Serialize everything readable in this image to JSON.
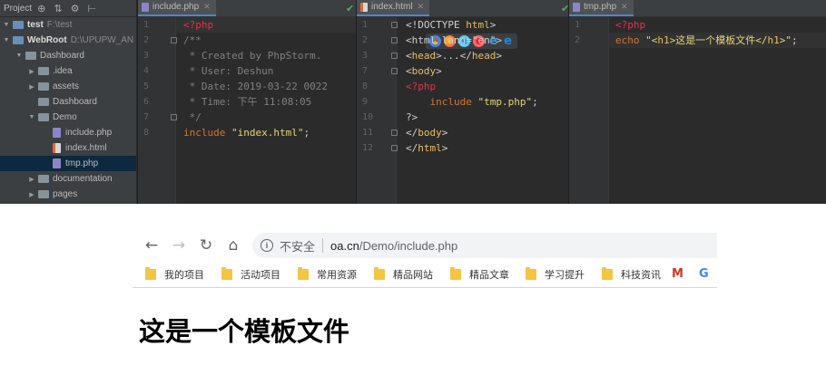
{
  "project_panel": {
    "title": "Project",
    "toolbar_icons": [
      "target-icon",
      "collapse-icon",
      "settings-icon",
      "hide-icon"
    ],
    "tree": [
      {
        "name": "test",
        "path": "F:\\test",
        "depth": 0,
        "expanded": true,
        "kind": "root"
      },
      {
        "name": "WebRoot",
        "path": "D:\\UPUPW_AN",
        "depth": 0,
        "expanded": true,
        "kind": "root"
      },
      {
        "name": "Dashboard",
        "path": "",
        "depth": 1,
        "expanded": true,
        "kind": "folder"
      },
      {
        "name": ".idea",
        "path": "",
        "depth": 2,
        "expanded": false,
        "kind": "folder"
      },
      {
        "name": "assets",
        "path": "",
        "depth": 2,
        "expanded": false,
        "kind": "folder"
      },
      {
        "name": "Dashboard",
        "path": "",
        "depth": 2,
        "expanded": null,
        "kind": "folder"
      },
      {
        "name": "Demo",
        "path": "",
        "depth": 2,
        "expanded": true,
        "kind": "folder"
      },
      {
        "name": "include.php",
        "path": "",
        "depth": 3,
        "expanded": null,
        "kind": "php"
      },
      {
        "name": "index.html",
        "path": "",
        "depth": 3,
        "expanded": null,
        "kind": "html"
      },
      {
        "name": "tmp.php",
        "path": "",
        "depth": 3,
        "expanded": null,
        "kind": "php",
        "selected": true
      },
      {
        "name": "documentation",
        "path": "",
        "depth": 2,
        "expanded": false,
        "kind": "folder"
      },
      {
        "name": "pages",
        "path": "",
        "depth": 2,
        "expanded": false,
        "kind": "folder"
      }
    ]
  },
  "editors": [
    {
      "tab": "include.php",
      "lines": [
        {
          "n": "1",
          "parts": [
            [
              "<?php",
              "php"
            ]
          ]
        },
        {
          "n": "2",
          "parts": [
            [
              "/**",
              "cmt"
            ]
          ]
        },
        {
          "n": "3",
          "parts": [
            [
              " * Created by PhpStorm.",
              "cmt"
            ]
          ]
        },
        {
          "n": "4",
          "parts": [
            [
              " * User: Deshun",
              "cmt"
            ]
          ]
        },
        {
          "n": "5",
          "parts": [
            [
              " * Date: 2019-03-22 0022",
              "cmt"
            ]
          ]
        },
        {
          "n": "6",
          "parts": [
            [
              " * Time: 下午 11:08:05",
              "cmt"
            ]
          ]
        },
        {
          "n": "7",
          "parts": [
            [
              " */",
              "cmt"
            ]
          ]
        },
        {
          "n": "8",
          "parts": [
            [
              "include ",
              "phpkw"
            ],
            [
              "\"index.html\"",
              "strw"
            ],
            [
              ";",
              "ident"
            ]
          ]
        }
      ]
    },
    {
      "tab": "index.html",
      "lines": [
        {
          "n": "1",
          "parts": [
            [
              "<!DOCTYPE ",
              "ident"
            ],
            [
              "html",
              "tag"
            ],
            [
              ">",
              "ident"
            ]
          ]
        },
        {
          "n": "2",
          "parts": [
            [
              "<html lang=\"en\">",
              "ident"
            ]
          ]
        },
        {
          "n": "3",
          "parts": [
            [
              "<",
              "ident"
            ],
            [
              "head",
              "tag"
            ],
            [
              ">...</",
              "ident"
            ],
            [
              "head",
              "tag"
            ],
            [
              ">",
              "ident"
            ]
          ]
        },
        {
          "n": "7",
          "parts": [
            [
              "<",
              "ident"
            ],
            [
              "body",
              "tag"
            ],
            [
              ">",
              "ident"
            ]
          ]
        },
        {
          "n": "8",
          "parts": [
            [
              "<?php",
              "php"
            ]
          ]
        },
        {
          "n": "9",
          "parts": [
            [
              "    include ",
              "phpkw"
            ],
            [
              "\"tmp.php\"",
              "strw"
            ],
            [
              ";",
              "ident"
            ]
          ]
        },
        {
          "n": "10",
          "parts": [
            [
              "?>",
              "ident"
            ]
          ]
        },
        {
          "n": "11",
          "parts": [
            [
              "</",
              "ident"
            ],
            [
              "body",
              "tag"
            ],
            [
              ">",
              "ident"
            ]
          ]
        },
        {
          "n": "12",
          "parts": [
            [
              "</",
              "ident"
            ],
            [
              "html",
              "tag"
            ],
            [
              ">",
              "ident"
            ]
          ]
        }
      ]
    },
    {
      "tab": "tmp.php",
      "lines": [
        {
          "n": "1",
          "parts": [
            [
              "<?php",
              "php"
            ]
          ]
        },
        {
          "n": "2",
          "parts": [
            [
              "echo ",
              "phpkw"
            ],
            [
              "\"<",
              "strw"
            ],
            [
              "h1",
              "tag"
            ],
            [
              ">这是一个模板文件</",
              "strw"
            ],
            [
              "h1",
              "tag"
            ],
            [
              ">\"",
              "strw"
            ],
            [
              ";",
              "ident"
            ]
          ]
        }
      ]
    }
  ],
  "browser": {
    "back_icon": "back-arrow-icon",
    "forward_icon": "forward-arrow-icon",
    "reload_icon": "reload-icon",
    "home_icon": "home-icon",
    "security_label": "不安全",
    "url_host": "oa.cn",
    "url_path": "/Demo/include.php",
    "bookmarks": [
      "我的项目",
      "活动项目",
      "常用资源",
      "精品网站",
      "精品文章",
      "学习提升",
      "科技资讯"
    ],
    "bookmark_gmail": "M",
    "bookmark_google": "G",
    "page_heading": "这是一个模板文件"
  },
  "colors": {
    "ide_bg": "#2b2b2b",
    "panel_bg": "#3c3f41",
    "php_tag": "#e8304a",
    "keyword": "#cc7832",
    "string": "#e6d676",
    "comment": "#808080",
    "html_tag": "#e8bf6a",
    "bookmark_folder": "#f4c542"
  }
}
